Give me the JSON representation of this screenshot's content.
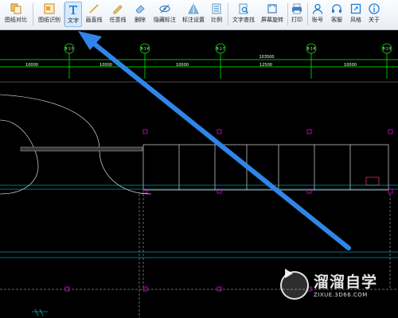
{
  "toolbar": {
    "items": [
      {
        "label": "图纸对比",
        "icon": "compare-icon"
      },
      {
        "label": "图纸识别",
        "icon": "recognize-icon"
      },
      {
        "label": "文字",
        "icon": "text-icon"
      },
      {
        "label": "画直线",
        "icon": "line-icon"
      },
      {
        "label": "任意线",
        "icon": "freehand-icon"
      },
      {
        "label": "删除",
        "icon": "eraser-icon"
      },
      {
        "label": "隐藏标注",
        "icon": "eye-hide-icon"
      },
      {
        "label": "标注设置",
        "icon": "annotation-settings-icon"
      },
      {
        "label": "比例",
        "icon": "ratio-icon"
      },
      {
        "label": "文字查找",
        "icon": "text-search-icon"
      },
      {
        "label": "屏幕旋转",
        "icon": "screen-rotate-icon"
      },
      {
        "label": "打印",
        "icon": "print-icon"
      },
      {
        "label": "账号",
        "icon": "user-icon"
      },
      {
        "label": "客服",
        "icon": "headset-icon"
      },
      {
        "label": "风格",
        "icon": "style-icon"
      },
      {
        "label": "关于",
        "icon": "info-icon"
      }
    ],
    "active_item": "文字",
    "accent_color": "#1e6fd0"
  },
  "drawing": {
    "axis_labels": [
      "B-1-5",
      "B-1-6",
      "B-1-7",
      "B-1-8",
      "B-1-9"
    ],
    "dimensions": [
      "10000",
      "10000",
      "10000",
      "12500",
      "10000"
    ],
    "total_dimension": "103500",
    "colors": {
      "background": "#000000",
      "axis": "#00ff00",
      "structure": "#ffffff",
      "column": "#ff00ff",
      "cyan_line": "#00e5ff",
      "arrow": "#2f86e8"
    }
  },
  "watermark": {
    "title": "溜溜自学",
    "url": "ZIXUE.3D66.COM"
  }
}
